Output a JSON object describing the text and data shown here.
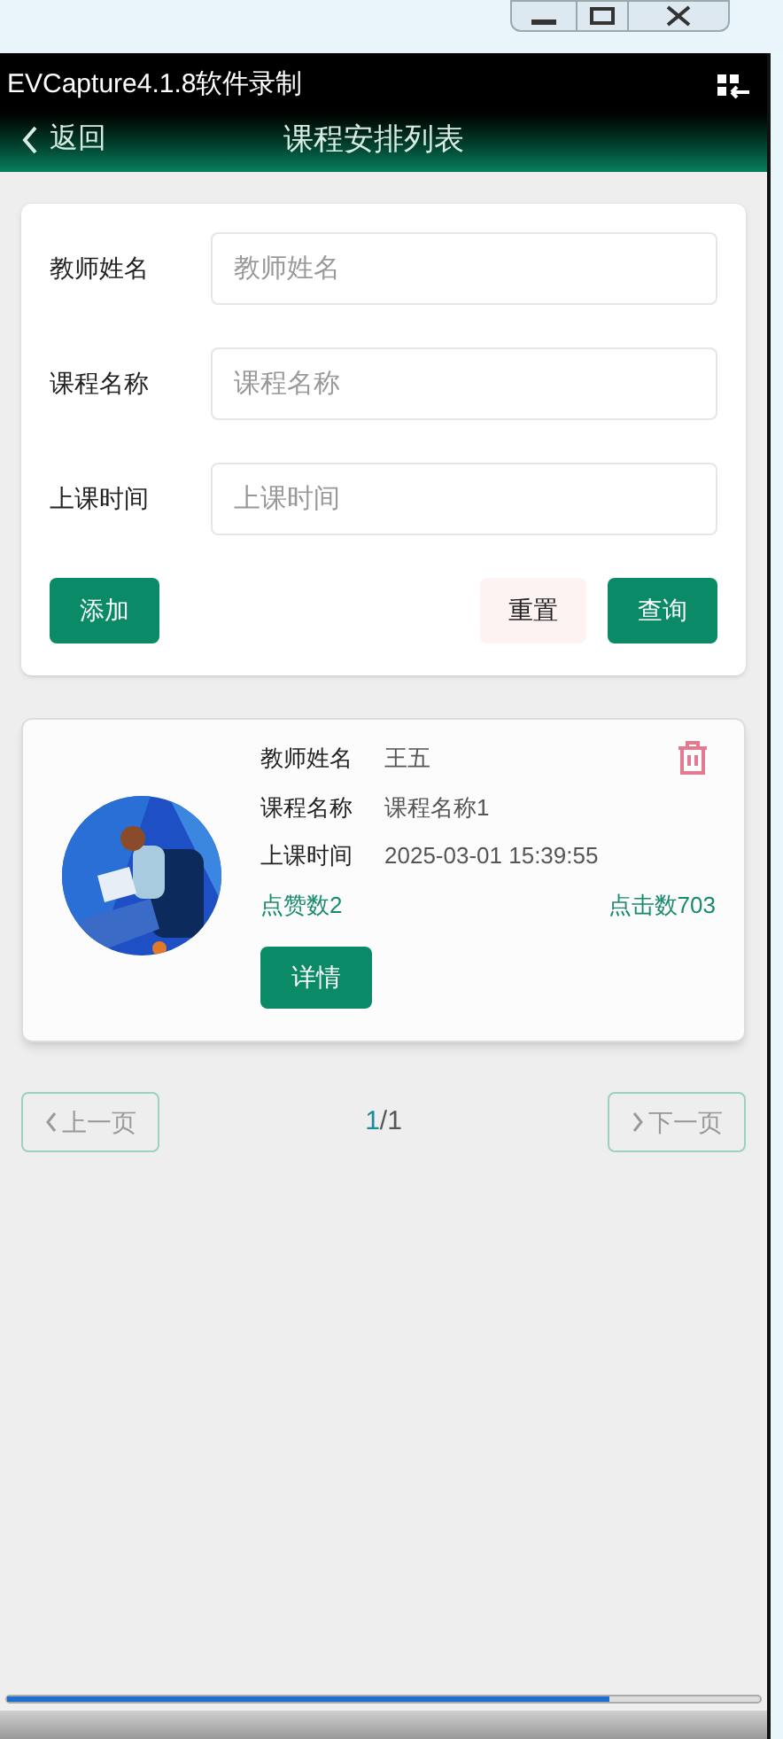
{
  "capture_bar": {
    "title": "EVCapture4.1.8软件录制"
  },
  "header": {
    "back": "返回",
    "title": "课程安排列表"
  },
  "form": {
    "fields": [
      {
        "label": "教师姓名",
        "placeholder": "教师姓名"
      },
      {
        "label": "课程名称",
        "placeholder": "课程名称"
      },
      {
        "label": "上课时间",
        "placeholder": "上课时间"
      }
    ],
    "add": "添加",
    "reset": "重置",
    "search": "查询"
  },
  "items": [
    {
      "kind": "picture",
      "rows": [
        {
          "label": "教师姓名",
          "value": "王五"
        },
        {
          "label": "课程名称",
          "value": "课程名称1"
        },
        {
          "label": "上课时间",
          "value": "2025-03-01 15:39:55"
        }
      ],
      "likes": "点赞数2",
      "clicks": "点击数703",
      "detail": "详情"
    }
  ],
  "pagination": {
    "prev": "上一页",
    "page": "1",
    "total": "/1",
    "next": "下一页"
  },
  "playback": {
    "level": 0.8
  }
}
